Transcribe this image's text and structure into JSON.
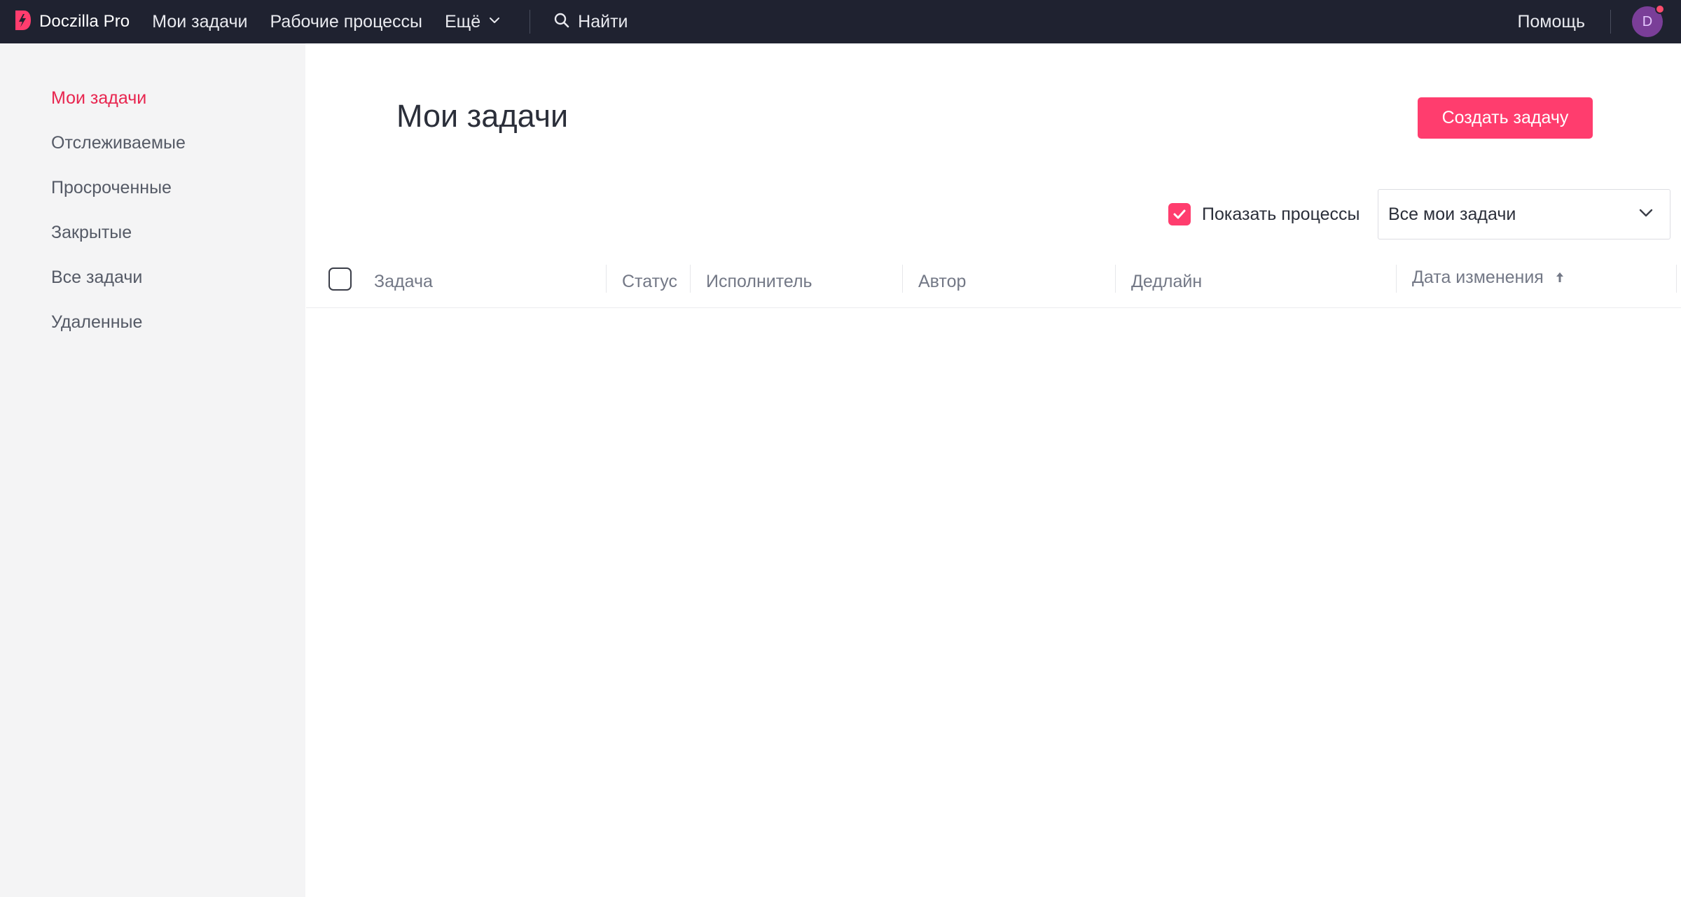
{
  "topbar": {
    "brand": "Doczilla Pro",
    "nav": [
      "Мои задачи",
      "Рабочие процессы"
    ],
    "more_label": "Ещё",
    "search_label": "Найти",
    "help_label": "Помощь",
    "avatar_initial": "D"
  },
  "sidebar": {
    "items": [
      {
        "label": "Мои задачи",
        "active": true
      },
      {
        "label": "Отслеживаемые"
      },
      {
        "label": "Просроченные"
      },
      {
        "label": "Закрытые"
      },
      {
        "label": "Все задачи"
      },
      {
        "label": "Удаленные"
      }
    ]
  },
  "main": {
    "title": "Мои задачи",
    "create_button": "Создать задачу",
    "show_processes_label": "Показать процессы",
    "show_processes_checked": true,
    "filter_value": "Все мои задачи",
    "columns": [
      "Задача",
      "Статус",
      "Исполнитель",
      "Автор",
      "Дедлайн",
      "Дата изменения"
    ],
    "sort_column": "Дата изменения",
    "sort_direction": "ascending",
    "rows": []
  },
  "colors": {
    "topbar_bg": "#1f2230",
    "accent": "#ff3d6e",
    "active_nav": "#e8254f",
    "sidebar_bg": "#f4f4f5",
    "avatar_bg": "#7a3e98"
  }
}
